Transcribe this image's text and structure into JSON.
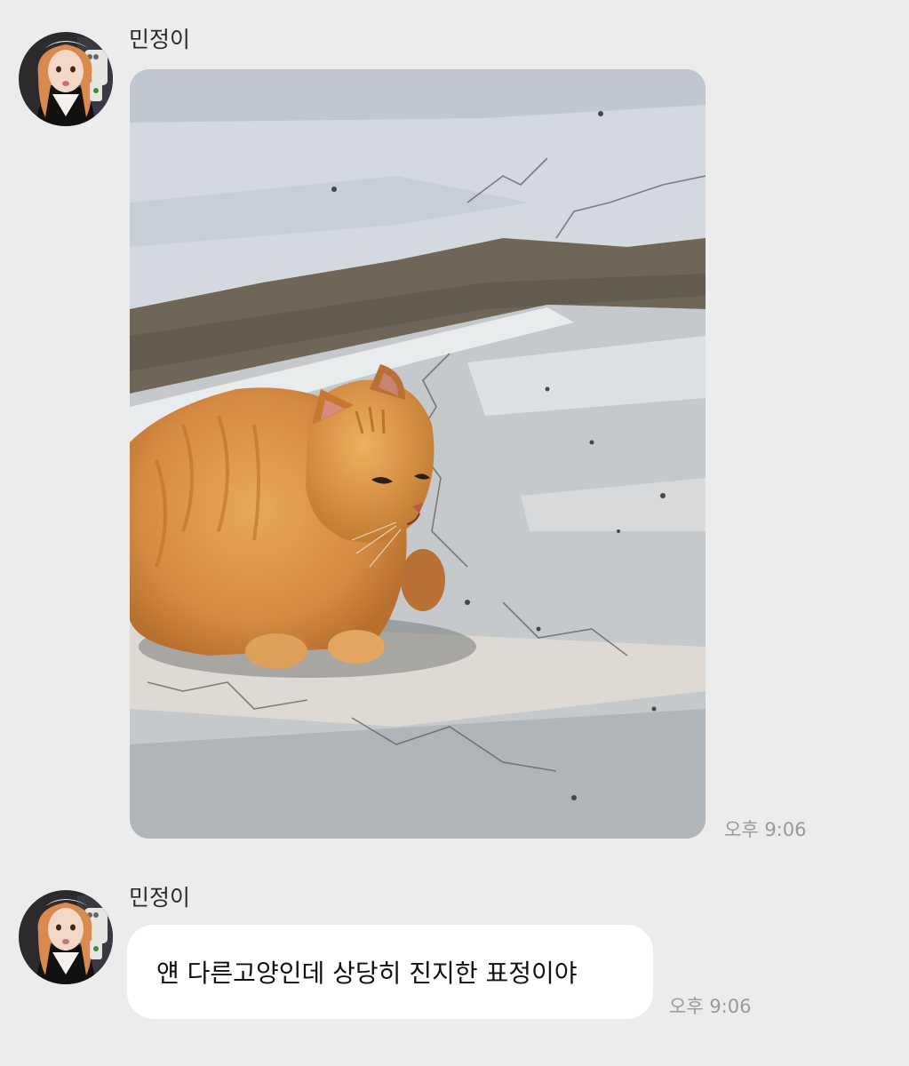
{
  "messages": [
    {
      "sender": "민정이",
      "type": "image",
      "image_subject": "orange-tabby-cat-on-pavement",
      "time": "오후 9:06"
    },
    {
      "sender": "민정이",
      "type": "text",
      "text": "얜 다른고양인데 상당히 진지한 표정이야",
      "time": "오후 9:06"
    }
  ],
  "colors": {
    "background": "#ececec",
    "bubble": "#ffffff",
    "timestamp": "#9a9a9a"
  }
}
